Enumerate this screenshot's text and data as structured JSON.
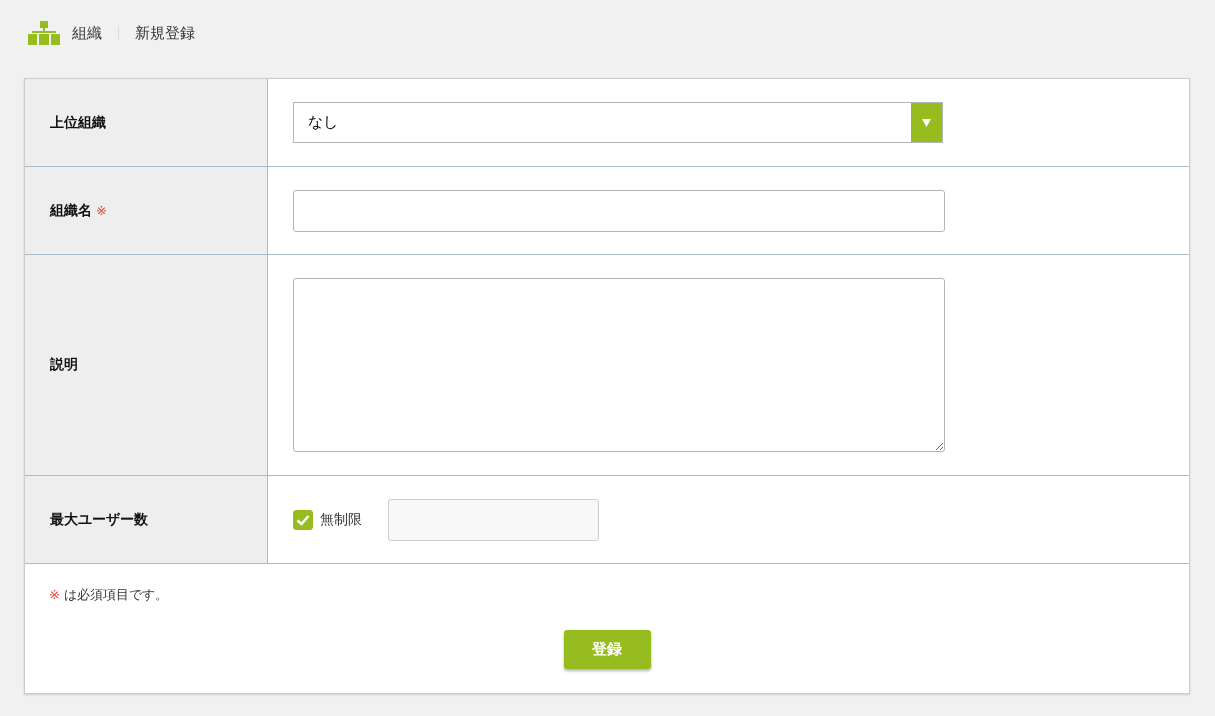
{
  "breadcrumb": {
    "section": "組織",
    "page": "新規登録"
  },
  "rows": [
    {
      "kind": "select",
      "label": "上位組織",
      "value": "なし"
    },
    {
      "kind": "text",
      "label": "組織名",
      "required_mark": "※"
    },
    {
      "kind": "textarea",
      "label": "説明"
    },
    {
      "kind": "limit",
      "label": "最大ユーザー数",
      "checkbox_label": "無制限",
      "checked": true
    }
  ],
  "note": {
    "mark": "※",
    "text": "は必須項目です。"
  },
  "submit": "登録"
}
